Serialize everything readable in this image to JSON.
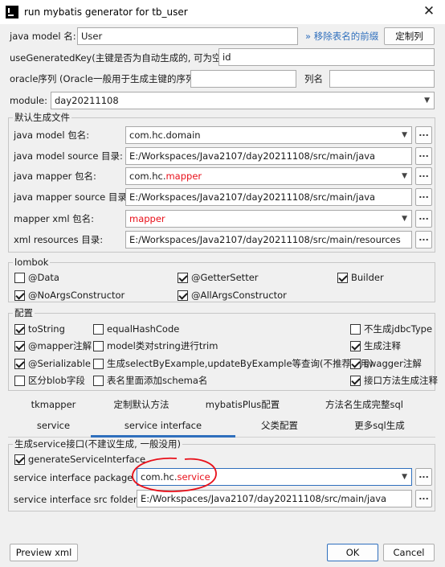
{
  "window": {
    "title": "run mybatis generator for tb_user",
    "close_glyph": "✕"
  },
  "top": {
    "model_name_label": "java model 名:",
    "model_name_value": "User",
    "remove_prefix_link": "» 移除表名的前缀",
    "custom_column_button": "定制列",
    "use_generated_key_label": "useGeneratedKey(主键是否为自动生成的, 可为空):",
    "use_generated_key_value": "id",
    "oracle_seq_label": "oracle序列 (Oracle一般用于生成主键的序列)",
    "oracle_seq_value": "",
    "column_name_label": "列名",
    "column_name_value": "",
    "module_label": "module:",
    "module_value": "day20211108"
  },
  "default_files": {
    "title": "默认生成文件",
    "rows": [
      {
        "label": "java model 包名:",
        "value_a": "com.hc.domain",
        "value_b": ""
      },
      {
        "label": "java model source 目录:",
        "value_a": "E:/Workspaces/Java2107/day20211108/src/main/java",
        "value_b": ""
      },
      {
        "label": "java mapper 包名:",
        "value_a": "com.hc.",
        "value_b": "mapper"
      },
      {
        "label": "java mapper source 目录:",
        "value_a": "E:/Workspaces/Java2107/day20211108/src/main/java",
        "value_b": ""
      },
      {
        "label": "mapper xml 包名:",
        "value_a": "",
        "value_b": "mapper"
      },
      {
        "label": "xml resources 目录:",
        "value_a": "E:/Workspaces/Java2107/day20211108/src/main/resources",
        "value_b": ""
      }
    ],
    "browse_label": "..."
  },
  "lombok": {
    "title": "lombok",
    "items": [
      {
        "label": "@Data",
        "checked": false
      },
      {
        "label": "@GetterSetter",
        "checked": true
      },
      {
        "label": "Builder",
        "checked": true
      },
      {
        "label": "@NoArgsConstructor",
        "checked": true
      },
      {
        "label": "@AllArgsConstructor",
        "checked": true
      }
    ]
  },
  "config": {
    "title": "配置",
    "items": [
      {
        "label": "toString",
        "checked": true
      },
      {
        "label": "equalHashCode",
        "checked": false
      },
      {
        "label": "不生成jdbcType",
        "checked": false
      },
      {
        "label": "@mapper注解",
        "checked": true
      },
      {
        "label": "model类对string进行trim",
        "checked": false
      },
      {
        "label": "生成注释",
        "checked": true
      },
      {
        "label": "@Serializable",
        "checked": true
      },
      {
        "label": "生成selectByExample,updateByExample等查询(不推荐使用)",
        "checked": false
      },
      {
        "label": "swagger注解",
        "checked": true
      },
      {
        "label": "区分blob字段",
        "checked": false
      },
      {
        "label": "表名里面添加schema名",
        "checked": false
      },
      {
        "label": "接口方法生成注释",
        "checked": true
      }
    ]
  },
  "tabs": {
    "row1": [
      "tkmapper",
      "定制默认方法",
      "mybatisPlus配置",
      "方法名生成完整sql"
    ],
    "row2": [
      "service",
      "service interface",
      "父类配置",
      "更多sql生成"
    ],
    "selected": "service interface"
  },
  "service_iface": {
    "title": "生成service接口(不建议生成, 一般没用)",
    "generate_label": "generateServiceInterface",
    "generate_checked": true,
    "package_label": "service interface package",
    "package_prefix": "com.hc.",
    "package_suffix": "service",
    "src_label": "service interface src folder",
    "src_value": "E:/Workspaces/Java2107/day20211108/src/main/java"
  },
  "footer": {
    "preview_button": "Preview xml",
    "ok_button": "OK",
    "cancel_button": "Cancel"
  },
  "colors": {
    "accent": "#2f6fbd",
    "highlight_red": "#e8101a",
    "annotation_red": "#e8101a"
  }
}
